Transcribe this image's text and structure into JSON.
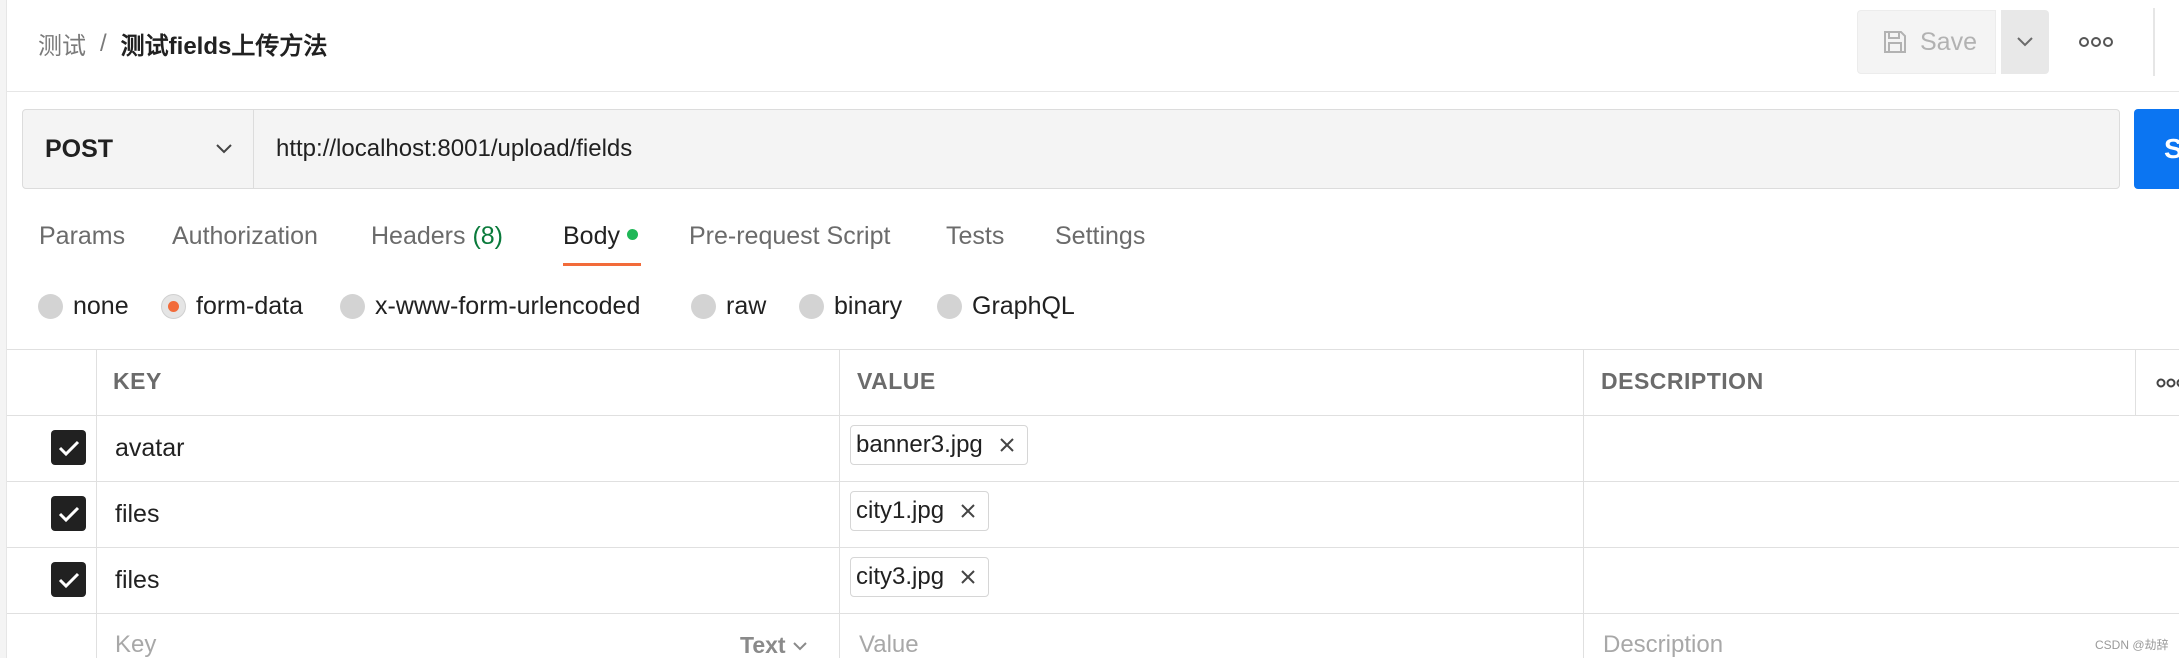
{
  "breadcrumb": {
    "parent": "测试",
    "separator": "/",
    "current": "测试fields上传方法"
  },
  "toolbar": {
    "save_label": "Save"
  },
  "request": {
    "method": "POST",
    "url": "http://localhost:8001/upload/fields",
    "send_label": "S"
  },
  "tabs": [
    {
      "label": "Params"
    },
    {
      "label": "Authorization"
    },
    {
      "label": "Headers",
      "count": "(8)"
    },
    {
      "label": "Body",
      "active": true
    },
    {
      "label": "Pre-request Script"
    },
    {
      "label": "Tests"
    },
    {
      "label": "Settings"
    }
  ],
  "body_types": [
    {
      "label": "none"
    },
    {
      "label": "form-data",
      "selected": true
    },
    {
      "label": "x-www-form-urlencoded"
    },
    {
      "label": "raw"
    },
    {
      "label": "binary"
    },
    {
      "label": "GraphQL"
    }
  ],
  "table": {
    "columns": [
      "KEY",
      "VALUE",
      "DESCRIPTION"
    ],
    "rows": [
      {
        "checked": true,
        "key": "avatar",
        "value": "banner3.jpg"
      },
      {
        "checked": true,
        "key": "files",
        "value": "city1.jpg"
      },
      {
        "checked": true,
        "key": "files",
        "value": "city3.jpg"
      }
    ],
    "new_row": {
      "key_placeholder": "Key",
      "type": "Text",
      "value_placeholder": "Value",
      "description_placeholder": "Description"
    }
  },
  "watermark": "CSDN @劫辞",
  "colors": {
    "accent": "#f26b3a",
    "send": "#0b75f2",
    "dot": "#1fb757"
  }
}
